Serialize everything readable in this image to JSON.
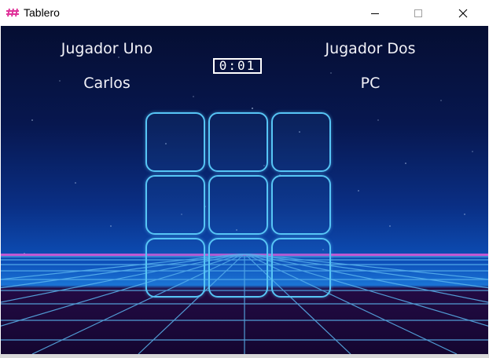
{
  "window": {
    "title": "Tablero",
    "icon": "logo-icon",
    "controls": [
      "minimize-icon",
      "maximize-icon",
      "close-icon"
    ]
  },
  "players": {
    "one": {
      "title": "Jugador Uno",
      "name": "Carlos"
    },
    "two": {
      "title": "Jugador Dos",
      "name": "PC"
    }
  },
  "timer": {
    "value": "0:01"
  },
  "board": {
    "rows": 3,
    "cols": 3,
    "cells": [
      "",
      "",
      "",
      "",
      "",
      "",
      "",
      "",
      ""
    ]
  },
  "colors": {
    "cell_border": "#57c5f5",
    "grid_line": "#5bb6f0",
    "horizon_glow": "#e05ad8",
    "sky_top": "#050e32"
  }
}
